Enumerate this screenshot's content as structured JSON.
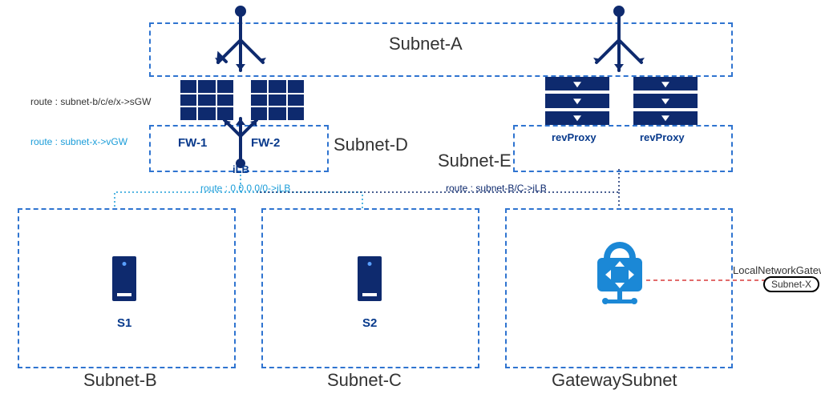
{
  "subnets": {
    "a": "Subnet-A",
    "b": "Subnet-B",
    "c": "Subnet-C",
    "d": "Subnet-D",
    "e": "Subnet-E",
    "gw": "GatewaySubnet"
  },
  "devices": {
    "fw1": "FW-1",
    "fw2": "FW-2",
    "ilb": "iLB",
    "rp1": "revProxy",
    "rp2": "revProxy",
    "s1": "S1",
    "s2": "S2"
  },
  "routes": {
    "sgw": "route : subnet-b/c/e/x->sGW",
    "vgw": "route : subnet-x->vGW",
    "default_ilb": "route : 0.0.0.0/0->iLB",
    "bc_ilb": "route : subnet-B/C->iLB"
  },
  "external": {
    "lng": "LocalNetworkGateway",
    "subnetx": "Subnet-X"
  },
  "colors": {
    "azure": "#1b9dd9",
    "navy": "#0e2a6e",
    "red": "#d83b3b"
  }
}
